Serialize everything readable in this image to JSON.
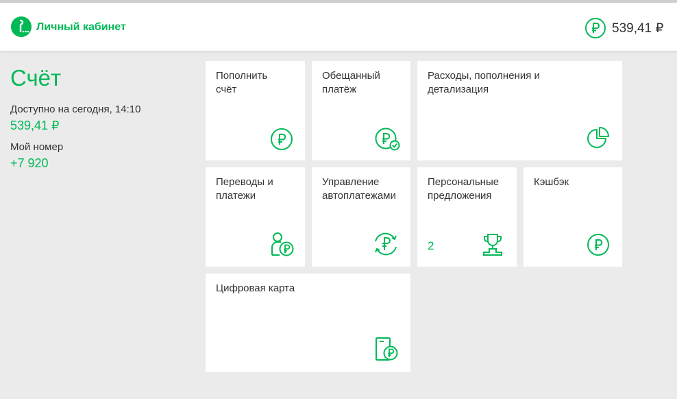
{
  "header": {
    "brand": "Личный кабинет",
    "balance": "539,41 ₽"
  },
  "account": {
    "title": "Счёт",
    "available_label": "Доступно на сегодня, 14:10",
    "available_value": "539,41 ₽",
    "number_label": "Мой номер",
    "number_value": "+7 920"
  },
  "tiles": [
    {
      "label": "Пополнить\nсчёт",
      "icon": "ruble-icon"
    },
    {
      "label": "Обещанный\nплатёж",
      "icon": "ruble-check-icon"
    },
    {
      "label": "Расходы, пополнения и\nдетализация",
      "icon": "pie-chart-icon"
    },
    {
      "label": "Переводы и\nплатежи",
      "icon": "person-ruble-icon"
    },
    {
      "label": "Управление\nавтоплатежами",
      "icon": "ruble-cycle-icon"
    },
    {
      "label": "Персональные\nпредложения",
      "icon": "trophy-icon",
      "count": "2"
    },
    {
      "label": "Кэшбэк",
      "icon": "ruble-icon"
    },
    {
      "label": "Цифровая карта",
      "icon": "card-ruble-icon"
    }
  ],
  "colors": {
    "accent": "#00b956",
    "background": "#ebebeb",
    "tile": "#ffffff",
    "text": "#333333"
  }
}
